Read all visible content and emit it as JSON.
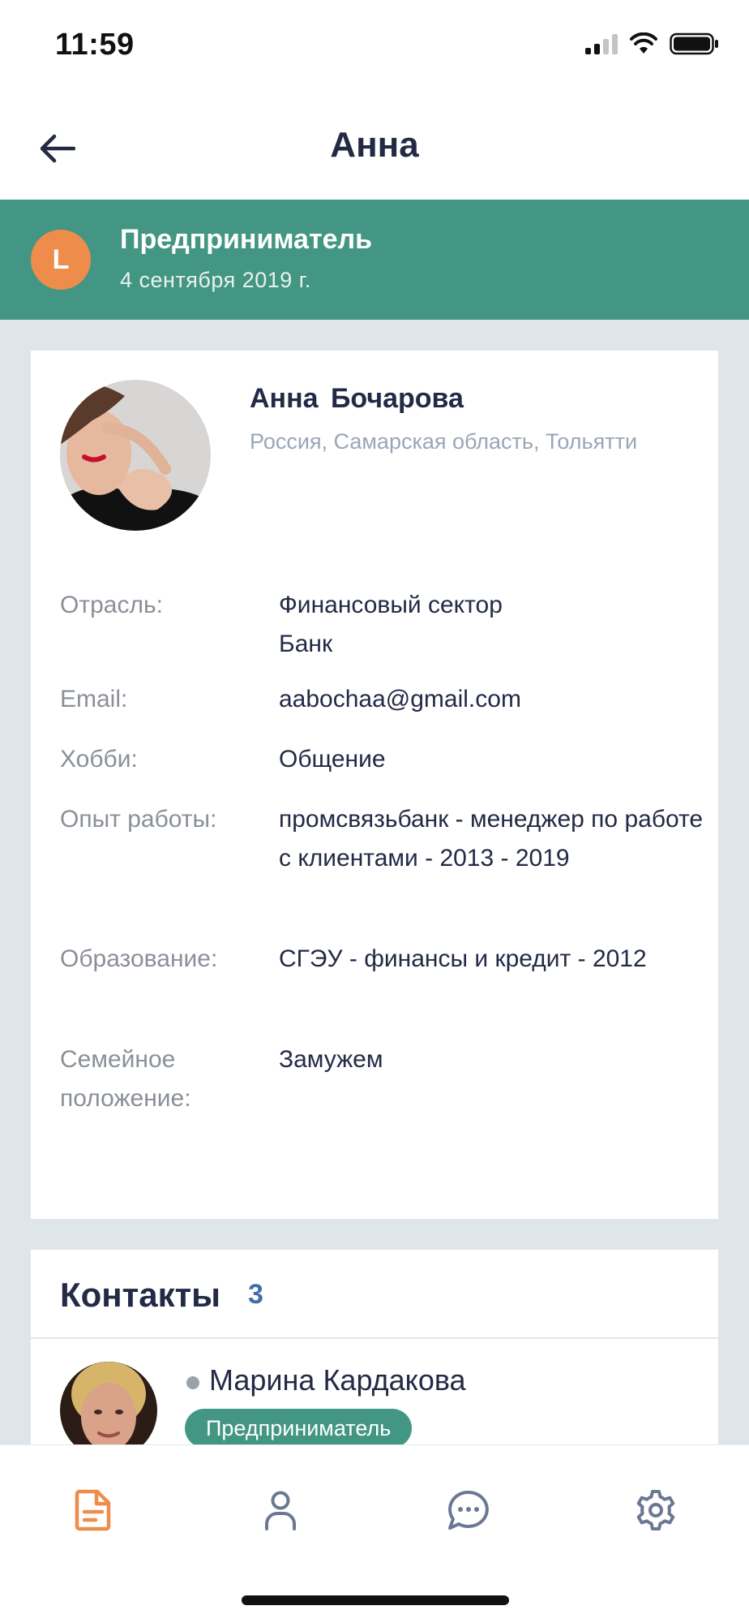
{
  "status_bar": {
    "time": "11:59"
  },
  "nav": {
    "title": "Анна"
  },
  "header": {
    "avatar_letter": "L",
    "type": "Предприниматель",
    "date": "4 сентября 2019 г."
  },
  "profile": {
    "name": "Анна  Бочарова",
    "location": "Россия, Самарская область, Тольятти",
    "fields": [
      {
        "label": "Отрасль:",
        "value": "Финансовый сектор\n Банк"
      },
      {
        "label": "Email:",
        "value": "aabochaa@gmail.com"
      },
      {
        "label": "Хобби:",
        "value": "Общение"
      },
      {
        "label": "Опыт работы:",
        "value": "промсвязьбанк - менеджер по работе с клиентами - 2013 - 2019"
      },
      {
        "label": "Образование:",
        "value": "СГЭУ - финансы и кредит - 2012"
      },
      {
        "label": "Семейное положение:",
        "value": "Замужем"
      }
    ]
  },
  "contacts": {
    "title": "Контакты",
    "count": "3",
    "items": [
      {
        "name": "Марина Кардакова",
        "badge": "Предприниматель"
      }
    ]
  },
  "tabs": [
    {
      "icon": "document-icon",
      "active": true
    },
    {
      "icon": "profile-icon",
      "active": false
    },
    {
      "icon": "chat-icon",
      "active": false
    },
    {
      "icon": "gear-icon",
      "active": false
    }
  ],
  "colors": {
    "accent_green": "#439683",
    "avatar_orange": "#ee8d4b",
    "active_tab": "#ee8d4b",
    "inactive_tab": "#6b7893",
    "count_blue": "#3f6fa8"
  }
}
